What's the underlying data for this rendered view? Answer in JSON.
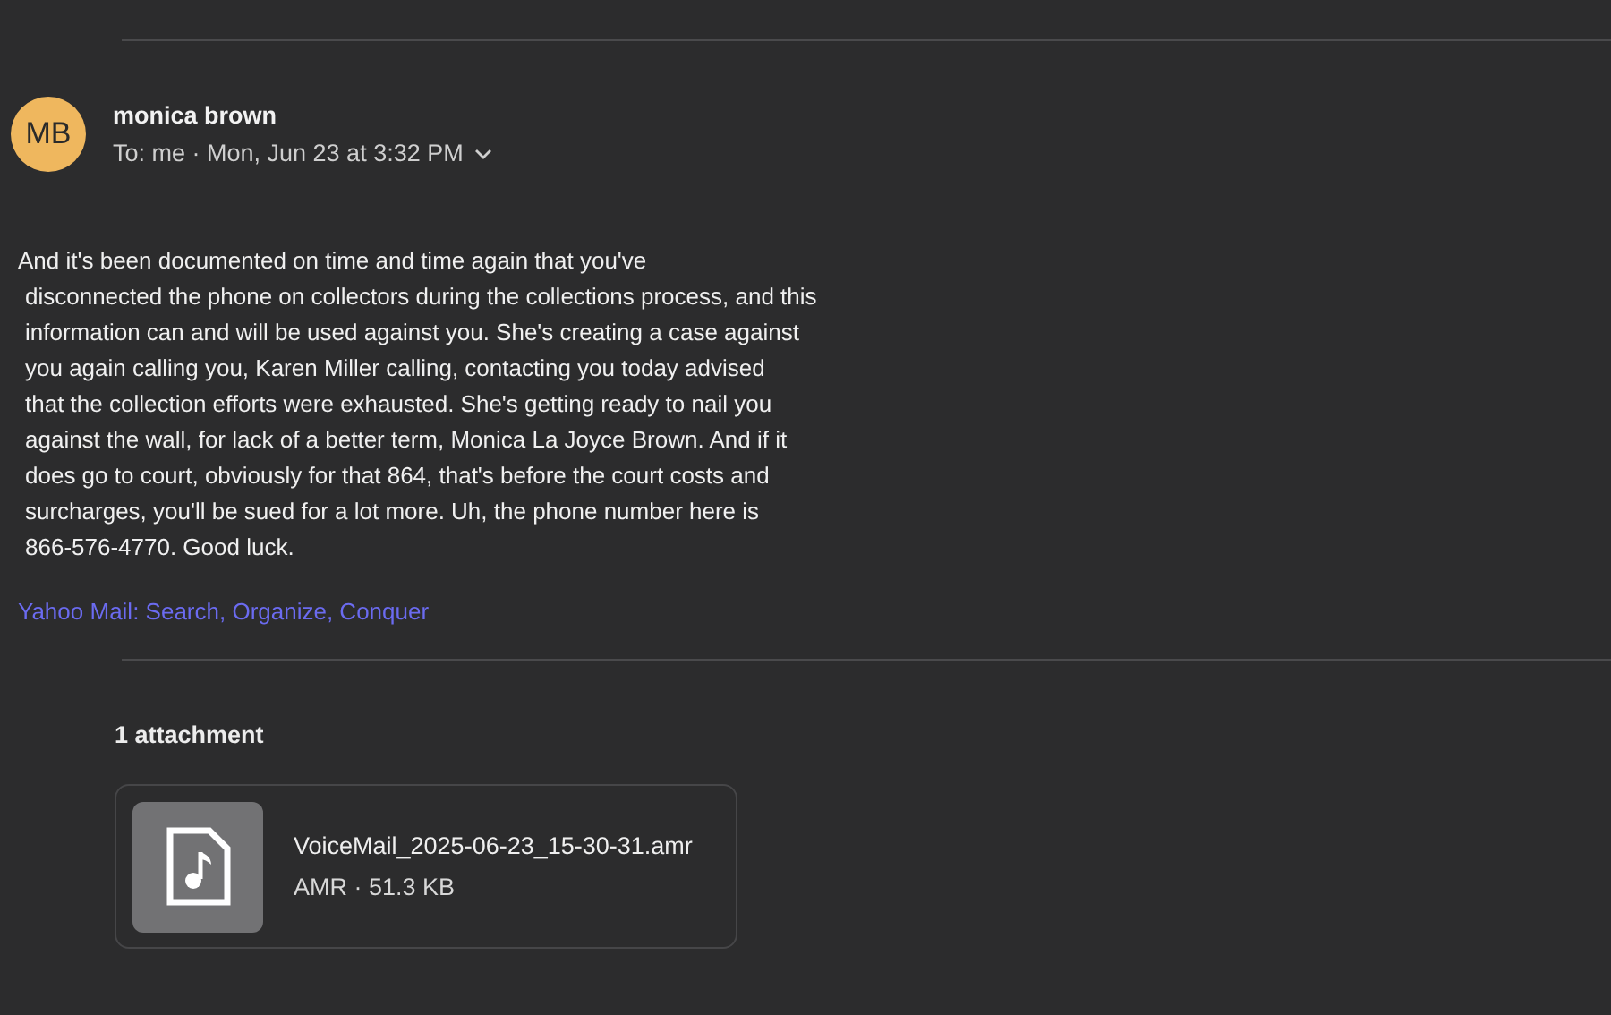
{
  "sender": {
    "initials": "MB",
    "name": "monica brown",
    "recipient_line": "To:  me · Mon, Jun 23 at 3:32 PM"
  },
  "body_lines": [
    "And it's been documented on time and time again that you've",
    "disconnected the phone on collectors during the collections process, and this",
    "information can and will be used against you. She's creating a case against",
    "you again calling you, Karen Miller calling, contacting you today advised",
    "that the collection efforts were exhausted. She's getting ready to nail you",
    "against the wall, for lack of a better term, Monica La Joyce Brown. And if it",
    "does go to court, obviously for that 864, that's before the court costs and",
    "surcharges, you'll be sued for a lot more. Uh, the phone number here is",
    "866-576-4770. Good luck."
  ],
  "signature_link": "Yahoo Mail: Search, Organize, Conquer",
  "attachments_heading": "1 attachment",
  "attachments": [
    {
      "filename": "VoiceMail_2025-06-23_15-30-31.amr",
      "details": "AMR · 51.3 KB"
    }
  ]
}
